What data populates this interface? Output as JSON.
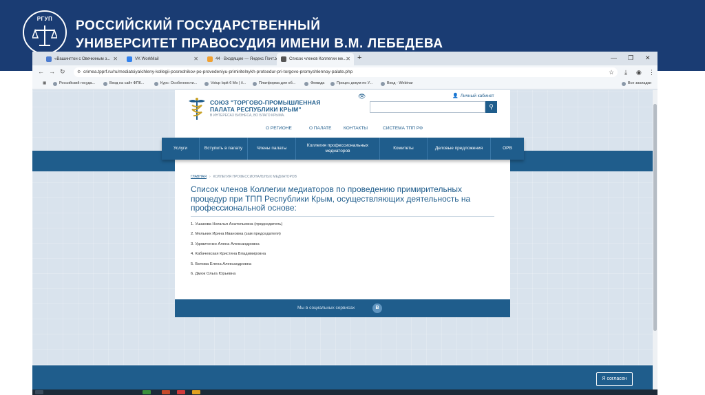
{
  "slide": {
    "logo_text": "РГУП",
    "title_line_1": "РОССИЙСКИЙ ГОСУДАРСТВЕННЫЙ",
    "title_line_2": "УНИВЕРСИТЕТ ПРАВОСУДИЯ ИМЕНИ В.М. ЛЕБЕДЕВА"
  },
  "browser": {
    "tabs": [
      {
        "label": "«Вашингтон с Овечкиным з...",
        "active": false,
        "color": "#4a7bd0"
      },
      {
        "label": "VK WorkMail",
        "active": false,
        "color": "#2f80ed"
      },
      {
        "label": "44 · Входящие — Яндекс Почт...",
        "active": false,
        "color": "#f0a030"
      },
      {
        "label": "Список членов Коллегии ме...",
        "active": true,
        "color": "#555555"
      }
    ],
    "new_tab": "+",
    "url": "crimea.tpprf.ru/ru/mediatsiya/chleny-kollegii-posrednikov-po-provedeniyu-primiritelnykh-protsedur-pri-torgovo-promyshlennoy-palate.php",
    "bookmarks": [
      "Российский госуда...",
      "Вход на сайт ФПК...",
      "Курс: Особенности...",
      "Vstup Ispit 6 Mo | /i...",
      "Платформа для об...",
      "Фемида",
      "Процес докум по У...",
      "Вход - Webinar"
    ],
    "bookmarks_other": "Все закладки"
  },
  "site": {
    "name_line_1": "СОЮЗ \"ТОРГОВО-ПРОМЫШЛЕННАЯ",
    "name_line_2": "ПАЛАТА РЕСПУБЛИКИ КРЫМ\"",
    "tagline": "В ИНТЕРЕСАХ БИЗНЕСА, ВО БЛАГО КРЫМА.",
    "cabinet": "Личный кабинет",
    "top_links": [
      "О РЕГИОНЕ",
      "О ПАЛАТЕ",
      "КОНТАКТЫ",
      "СИСТЕМА ТПП РФ"
    ],
    "menu": [
      "Услуги",
      "Вступить в палату",
      "Члены палаты",
      "Коллегия профессиональных медиаторов",
      "Комитеты",
      "Деловые предложения",
      "ОРВ"
    ],
    "breadcrumb_home": "ГЛАВНАЯ",
    "breadcrumb_current": "КОЛЛЕГИЯ ПРОФЕССИОНАЛЬНЫХ МЕДИАТОРОВ",
    "page_title": "Список членов Коллегии медиаторов по проведению примирительных процедур при ТПП Республики Крым, осуществляющих деятельность на профессиональной основе:",
    "members": [
      "1. Ушакова Наталья Анатольевна (председатель)",
      "2. Мельник Ирина Ивановна (зам председателя)",
      "3. Удовиченко Алена Александровна",
      "4. Кабачевская Кристина Владимировна",
      "5. Белова Елена Александровна",
      "6. Дмюк Ольга Юрьевна"
    ],
    "social_text": "Мы в социальных сервисах",
    "social_icon": "В",
    "cookie_button": "Я согласен"
  },
  "colors": {
    "slide_header": "#1a3c73",
    "site_primary": "#1f5d8c"
  }
}
